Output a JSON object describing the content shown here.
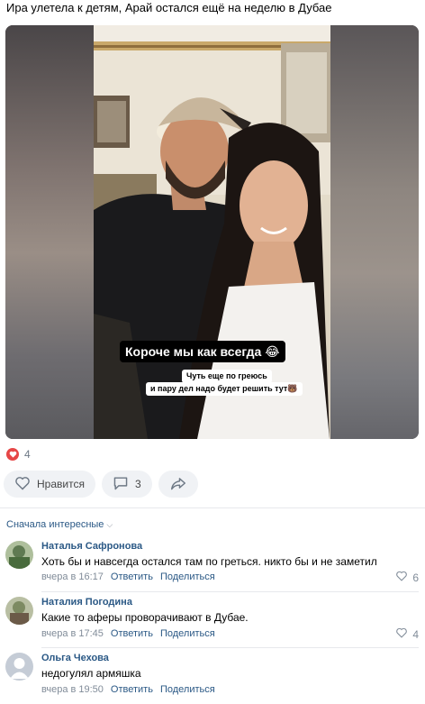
{
  "post": {
    "text": "Ира улетела к детям, Арай остался ещё на неделю в Дубае",
    "caption_main": "Короче мы как всегда 😂",
    "caption_line1": "Чуть еще по греюсь",
    "caption_line2": "и пару дел надо будет решить тут🐻",
    "likes_count": "4",
    "actions": {
      "like_label": "Нравится",
      "comments_count": "3"
    }
  },
  "comments_header": {
    "sort_label": "Сначала интересные",
    "chevron_icon": "chevron-down-icon"
  },
  "comments": [
    {
      "author": "Наталья Сафронова",
      "text": "Хоть бы и навсегда остался там по греться. никто бы и не заметил",
      "time": "вчера в 16:17",
      "reply": "Ответить",
      "share": "Поделиться",
      "likes": "6",
      "avatar_color": "#5f7a52"
    },
    {
      "author": "Наталия Погодина",
      "text": "Какие то аферы проворачивают в Дубае.",
      "time": "вчера в 17:45",
      "reply": "Ответить",
      "share": "Поделиться",
      "likes": "4",
      "avatar_color": "#7d8a62"
    },
    {
      "author": "Ольга Чехова",
      "text": "недогулял армяшка",
      "time": "вчера в 19:50",
      "reply": "Ответить",
      "share": "Поделиться",
      "likes": "",
      "avatar_color": "#c5ccd6"
    }
  ],
  "colors": {
    "link": "#2a5885",
    "muted": "#818c99",
    "heart": "#e64646",
    "pill_bg": "#f0f2f5"
  }
}
